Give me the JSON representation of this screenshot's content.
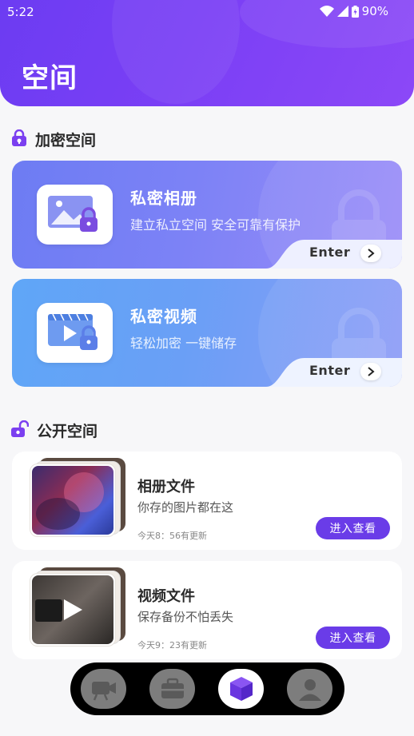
{
  "status_bar": {
    "time": "5:22",
    "battery": "90%",
    "icons": [
      "wifi-icon",
      "signal-icon",
      "battery-icon"
    ]
  },
  "header": {
    "title": "空间",
    "background": "#7a3ff5"
  },
  "encrypted_section": {
    "title": "加密空间",
    "icon": "lock-icon",
    "cards": [
      {
        "title": "私密相册",
        "subtitle": "建立私立空间 安全可靠有保护",
        "enter": "Enter",
        "icon": "private-album-icon"
      },
      {
        "title": "私密视频",
        "subtitle": "轻松加密 一键储存",
        "enter": "Enter",
        "icon": "private-video-icon"
      }
    ]
  },
  "public_section": {
    "title": "公开空间",
    "icon": "unlock-icon",
    "cards": [
      {
        "title": "相册文件",
        "subtitle": "你存的图片都在这",
        "updated": "今天8：56有更新",
        "button": "进入查看",
        "thumbnail": "photo-thumbnail"
      },
      {
        "title": "视频文件",
        "subtitle": "保存备份不怕丢失",
        "updated": "今天9：23有更新",
        "button": "进入查看",
        "thumbnail": "video-thumbnail"
      }
    ]
  },
  "bottom_nav": {
    "items": [
      {
        "icon": "video-camera-icon",
        "active": false
      },
      {
        "icon": "toolbox-icon",
        "active": false
      },
      {
        "icon": "cube-icon",
        "active": true
      },
      {
        "icon": "user-icon",
        "active": false
      }
    ]
  },
  "colors": {
    "accent": "#6a3ce8",
    "card1_gradient": "#6d7cf3",
    "card2_gradient": "#5fa6f7"
  }
}
